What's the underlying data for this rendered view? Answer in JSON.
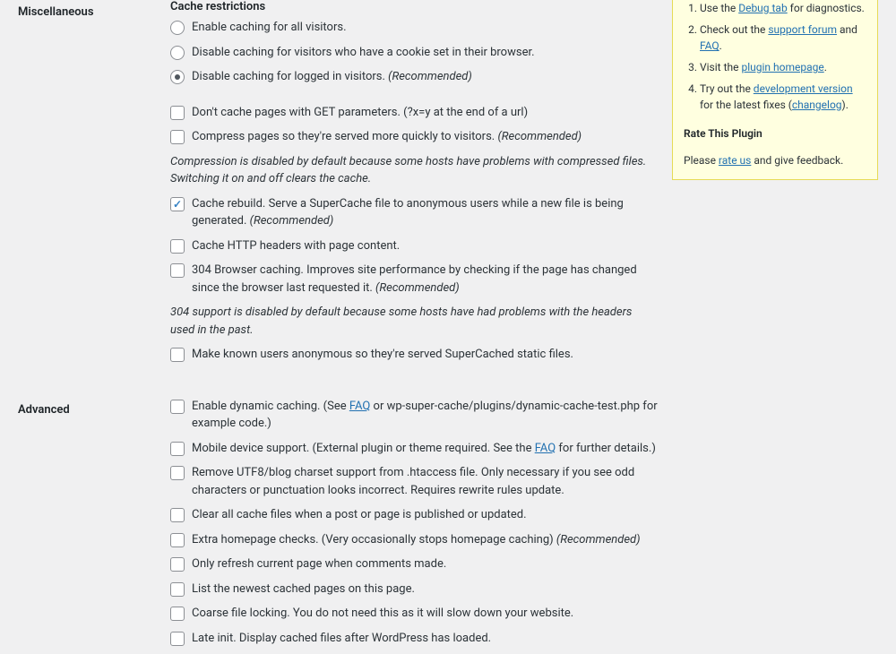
{
  "misc": {
    "label": "Miscellaneous",
    "heading": "Cache restrictions",
    "radio_all": "Enable caching for all visitors.",
    "radio_cookie": "Disable caching for visitors who have a cookie set in their browser.",
    "radio_loggedin": "Disable caching for logged in visitors.",
    "recommended": "(Recommended)",
    "get_params": "Don't cache pages with GET parameters. (?x=y at the end of a url)",
    "compress": "Compress pages so they're served more quickly to visitors.",
    "compress_note": "Compression is disabled by default because some hosts have problems with compressed files. Switching it on and off clears the cache.",
    "rebuild": "Cache rebuild. Serve a SuperCache file to anonymous users while a new file is being generated.",
    "http_headers": "Cache HTTP headers with page content.",
    "browser_304": "304 Browser caching. Improves site performance by checking if the page has changed since the browser last requested it.",
    "note_304": "304 support is disabled by default because some hosts have had problems with the headers used in the past.",
    "anonymous": "Make known users anonymous so they're served SuperCached static files."
  },
  "adv": {
    "label": "Advanced",
    "dynamic_pre": "Enable dynamic caching. (See ",
    "faq": "FAQ",
    "dynamic_post": " or wp-super-cache/plugins/dynamic-cache-test.php for example code.)",
    "mobile_pre": "Mobile device support. (External plugin or theme required. See the ",
    "mobile_post": " for further details.)",
    "utf8": "Remove UTF8/blog charset support from .htaccess file. Only necessary if you see odd characters or punctuation looks incorrect. Requires rewrite rules update.",
    "clear_cache": "Clear all cache files when a post or page is published or updated.",
    "homepage": "Extra homepage checks. (Very occasionally stops homepage caching)",
    "refresh": "Only refresh current page when comments made.",
    "list_newest": "List the newest cached pages on this page.",
    "coarse": "Coarse file locking. You do not need this as it will slow down your website.",
    "late_init": "Late init. Display cached files after WordPress has loaded."
  },
  "sidebar": {
    "item1_pre": "Use the ",
    "item1_link": "Debug tab",
    "item1_post": " for diagnostics.",
    "item2_pre": "Check out the ",
    "item2_link1": "support forum",
    "item2_mid": " and ",
    "item2_link2": "FAQ",
    "item2_post": ".",
    "item3_pre": "Visit the ",
    "item3_link": "plugin homepage",
    "item3_post": ".",
    "item4_pre": "Try out the ",
    "item4_link1": "development version",
    "item4_mid": " for the latest fixes (",
    "item4_link2": "changelog",
    "item4_post": ").",
    "rate_heading": "Rate This Plugin",
    "rate_pre": "Please ",
    "rate_link": "rate us",
    "rate_post": " and give feedback."
  }
}
